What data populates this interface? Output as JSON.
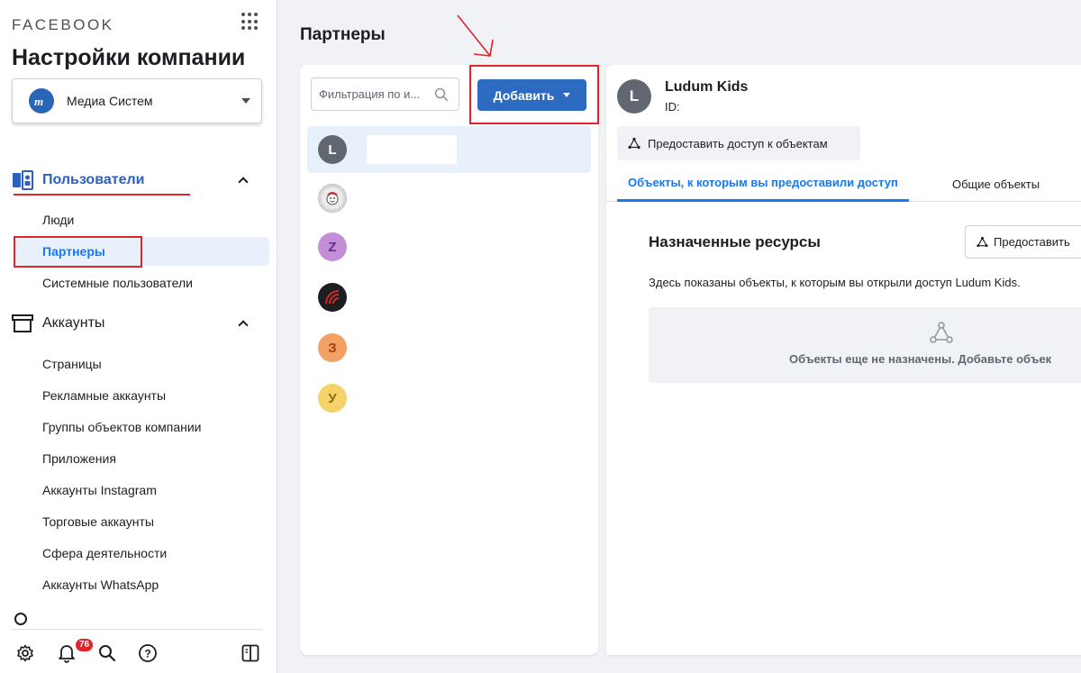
{
  "sidebar": {
    "brand": "FACEBOOK",
    "title": "Настройки компании",
    "company": {
      "name": "Медиа Систем",
      "logo_letter": "M"
    },
    "sections": [
      {
        "label": "Пользователи",
        "items": [
          "Люди",
          "Партнеры",
          "Системные пользователи"
        ]
      },
      {
        "label": "Аккаунты",
        "items": [
          "Страницы",
          "Рекламные аккаунты",
          "Группы объектов компании",
          "Приложения",
          "Аккаунты Instagram",
          "Торговые аккаунты",
          "Сфера деятельности",
          "Аккаунты WhatsApp"
        ]
      }
    ],
    "notifications_count": "76"
  },
  "page": {
    "title": "Партнеры"
  },
  "partners_list": {
    "filter_placeholder": "Фильтрация по и...",
    "add_button": "Добавить",
    "partners": [
      {
        "letter": "L",
        "color": "#606770"
      },
      {
        "letter": "",
        "color": "#d8d8d8"
      },
      {
        "letter": "Z",
        "color": "#c58ed9"
      },
      {
        "letter": "",
        "color": "#1c1e21"
      },
      {
        "letter": "З",
        "color": "#f2a064"
      },
      {
        "letter": "У",
        "color": "#f5d36a"
      }
    ]
  },
  "detail": {
    "avatar_letter": "L",
    "name": "Ludum Kids",
    "id_label": "ID:",
    "share_button": "Предоставить доступ к объектам",
    "tabs": [
      "Объекты, к которым вы предоставили доступ",
      "Общие объекты"
    ],
    "resources_title": "Назначенные ресурсы",
    "resources_button": "Предоставить",
    "resources_desc": "Здесь показаны объекты, к которым вы открыли доступ Ludum Kids.",
    "empty_text": "Объекты еще не назначены. Добавьте объек"
  },
  "colors": {
    "accent": "#1877f2",
    "button": "#2d6bc1",
    "annotation": "#e0242c"
  }
}
